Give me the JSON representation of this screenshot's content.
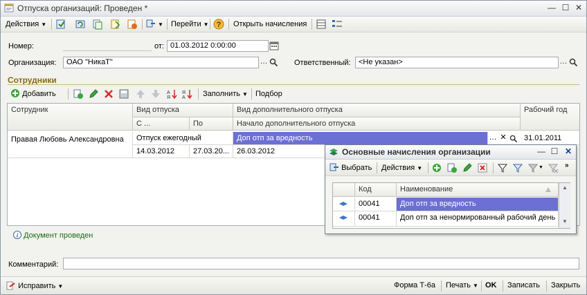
{
  "window": {
    "title": "Отпуска организаций: Проведен *"
  },
  "toolbar": {
    "actions_label": "Действия",
    "goto_label": "Перейти",
    "open_accruals_label": "Открыть начисления"
  },
  "form": {
    "number_label": "Номер:",
    "number_value": "",
    "from_label": "от:",
    "date_value": "01.03.2012  0:00:00",
    "org_label": "Организация:",
    "org_value": "ОАО \"НикаТ\"",
    "responsible_label": "Ответственный:",
    "responsible_value": "<Не указан>"
  },
  "employees": {
    "section_title": "Сотрудники",
    "add_label": "Добавить",
    "fill_label": "Заполнить",
    "select_label": "Подбор",
    "headers": {
      "employee": "Сотрудник",
      "vacation_type": "Вид отпуска",
      "extra_vacation_type": "Вид дополнительного отпуска",
      "work_year": "Рабочий год",
      "from": "С ...",
      "to": "По",
      "extra_start": "Начало дополнительного отпуска"
    },
    "rows": [
      {
        "employee": "Правая Любовь Александровна",
        "vacation_type": "Отпуск ежегодный",
        "extra_vacation_type": "Доп отп за вредность",
        "work_year": "31.01.2011",
        "from": "14.03.2012",
        "to": "27.03.20...",
        "extra_start": "26.03.2012"
      }
    ]
  },
  "popup": {
    "title": "Основные начисления организации",
    "select_label": "Выбрать",
    "actions_label": "Действия",
    "col_code": "Код",
    "col_name": "Наименование",
    "rows": [
      {
        "code": "00041",
        "name": "Доп отп за вредность"
      },
      {
        "code": "00041",
        "name": "Доп отп за ненормированный рабочий день"
      }
    ]
  },
  "status": {
    "text": "Документ проведен"
  },
  "comment": {
    "label": "Комментарий:",
    "value": ""
  },
  "bottom": {
    "fix_label": "Исправить",
    "form_label": "Форма Т-6а",
    "print_label": "Печать",
    "ok_label": "OK",
    "write_label": "Записать",
    "close_label": "Закрыть"
  }
}
